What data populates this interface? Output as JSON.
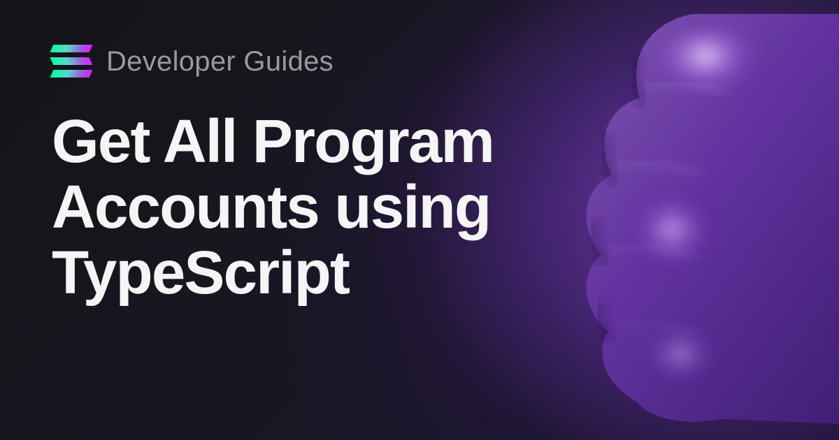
{
  "header": {
    "subtitle": "Developer Guides"
  },
  "title": "Get All Program Accounts using TypeScript"
}
